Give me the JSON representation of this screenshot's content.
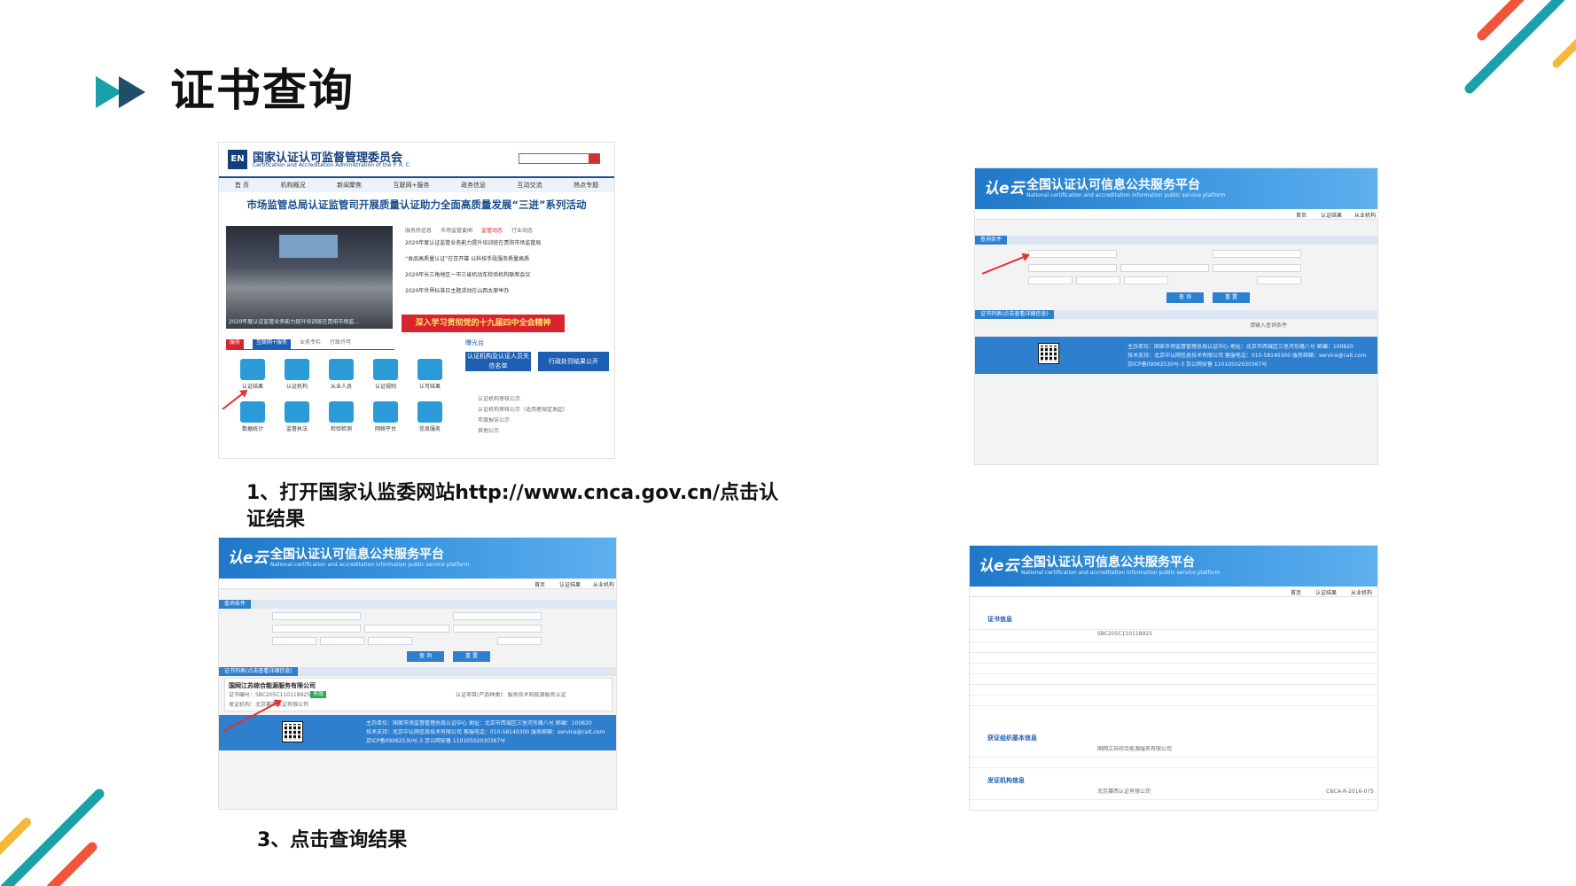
{
  "slide": {
    "title": "证书查询",
    "step1": "1、打开国家认监委网站http://www.cnca.gov.cn/点击认证结果",
    "step3": "3、点击查询结果"
  },
  "colors": {
    "title": "#111111",
    "accent_teal": "#1aa0a8",
    "accent_orange": "#f0553a",
    "accent_yellow": "#f5b83a",
    "platform_blue": "#2f7fcf",
    "cnca_blue": "#143f7d",
    "cnca_red": "#d9232e"
  },
  "cnca": {
    "logo": "EN",
    "name": "国家认证认可监督管理委员会",
    "name_en": "Certification and Accreditation Administration of the P. R. C",
    "nav": [
      "首 页",
      "机构概况",
      "新闻聚焦",
      "互联网+服务",
      "政务信息",
      "互动交流",
      "热点专题"
    ],
    "headline": "市场监管总局认证监管司开展质量认证助力全面高质量发展“三进”系列活动",
    "news_tabs": [
      "服务热信息",
      "市场监管要闻",
      "监管动态",
      "行业动态"
    ],
    "news": [
      "2020年度认证监管业务能力提升培训班在贵阳市场监管局",
      "“食品高质量认证”在京开幕 以科技手段服务质量高质",
      "2020年长三角地区一市三省机动车检验机构联席会议",
      "2020年世界标准日主题活动在山西太原举办"
    ],
    "photo_caption": "2020年度认证监管业务能力提升培训班在贵阳市场监…",
    "red_banner": "深入学习贯彻党的十九届四中全会精神",
    "service_tabs": [
      "服务",
      "互联网+服务",
      "业务专栏",
      "行政许可"
    ],
    "sunshine": "曝光台",
    "tiles": [
      "认证结果",
      "认证机构",
      "从业人员",
      "认证规则",
      "认可结果",
      "数据统计",
      "监督执法",
      "检验检测",
      "网络平台",
      "信息服务"
    ],
    "blue_buttons": [
      "认证机构及认证人员失信名单",
      "行政处罚结果公开"
    ],
    "side_links": [
      "认证机构审核公示",
      "认证机构审核公示（适用者规定发起）",
      "年度报告公示",
      "其他公示"
    ]
  },
  "platform": {
    "logo": "认e云",
    "title": "全国认证认可信息公共服务平台",
    "title_en": "National certification and accreditation information public service platform",
    "nav": [
      "首页",
      "认证结果",
      "从业机构"
    ],
    "query_btn": "查 询",
    "reset_btn": "重 置",
    "section_query": "查询条件",
    "section_results": "证书列表(点击查看详细信息)",
    "result_company": "国网江苏综合能源服务有限公司",
    "result_cert_no": "证书编号：SBC205C110118925",
    "result_status": "有效",
    "result_org": "发证机构：北京赛西认证有限公司",
    "result_scope": "认证项目(产品种类)：服务技术和能源服务认证",
    "no_result": "请输入查询条件",
    "detail_section_1": "证书信息",
    "detail_section_2": "获证组织基本信息",
    "detail_section_3": "发证机构信息",
    "detail_company": "国网江苏综合能源服务有限公司",
    "detail_org": "北京赛西认证有限公司",
    "detail_cert_no": "SBC205C110118925",
    "detail_org_no": "CNCA-R-2016-075",
    "footer_lines": [
      "主办单位：国家市场监督管理总局认证中心 地址：北京市西城区三里河东路八号 邮编：100820",
      "技术支持：北京中认网信息技术有限公司 客服电话：010-58140300 服务邮箱：service@cait.com",
      "京ICP备09062530号-3 京公网安备 11010502030367号"
    ]
  }
}
